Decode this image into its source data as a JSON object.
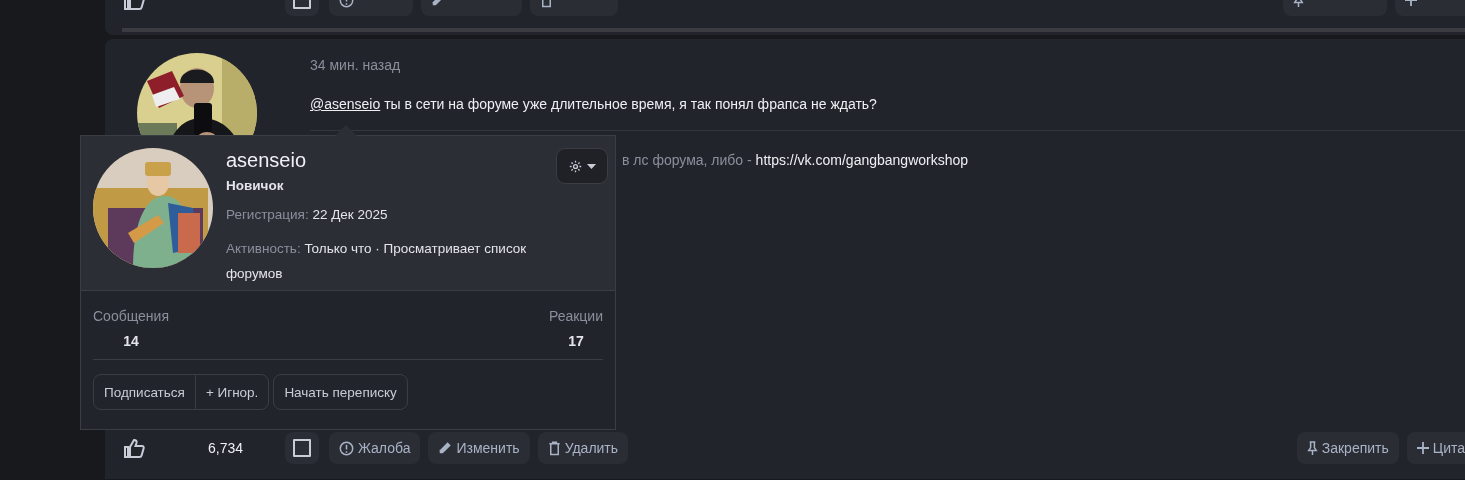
{
  "previous_post": {
    "checked": false,
    "actions": [
      {
        "kind": "report"
      },
      {
        "kind": "edit"
      },
      {
        "kind": "delete"
      }
    ],
    "right_actions": [
      {
        "kind": "pin"
      },
      {
        "kind": "quote"
      }
    ]
  },
  "post": {
    "time": "34 мин. назад",
    "mention": "@asenseio",
    "message": "ты в сети на форуме уже длительное время, я так понял фрапса не ждать?",
    "signature": {
      "text": "в лс форума, либо - ",
      "link": "https://vk.com/gangbangworkshop"
    },
    "like_count": "6,734",
    "checked": false,
    "actions": [
      {
        "kind": "report",
        "label": "Жалоба"
      },
      {
        "kind": "edit",
        "label": "Изменить"
      },
      {
        "kind": "delete",
        "label": "Удалить"
      }
    ],
    "right_actions": [
      {
        "kind": "pin",
        "label": "Закрепить"
      },
      {
        "kind": "quote",
        "label": "Цита"
      }
    ]
  },
  "member_tooltip": {
    "username": "asenseio",
    "user_title": "Новичок",
    "fields": [
      {
        "label": "Регистрация:",
        "value": "22 Дек 2025"
      },
      {
        "label": "Активность:",
        "value": "Только что · Просматривает список форумов"
      }
    ],
    "stats": [
      {
        "label": "Сообщения",
        "value": "14"
      },
      {
        "label": "Реакции",
        "value": "17"
      }
    ],
    "button_group": [
      "Подписаться",
      "+ Игнор."
    ],
    "buttons": [
      "Начать переписку"
    ]
  }
}
